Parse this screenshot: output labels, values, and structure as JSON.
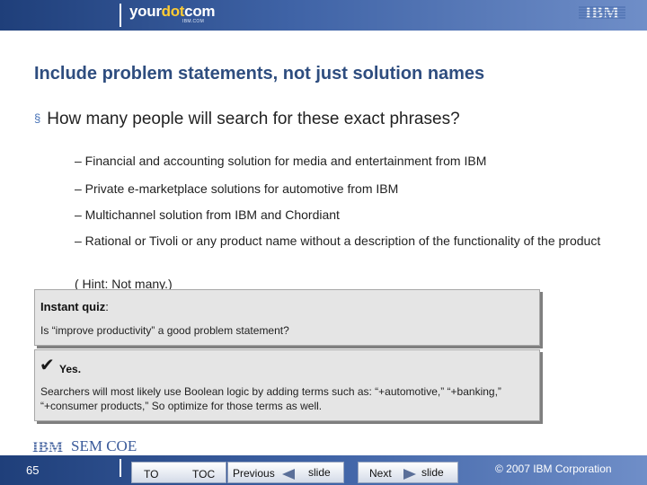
{
  "header": {
    "logo_prefix": "your",
    "logo_dot": "dot",
    "logo_suffix": "com",
    "logo_sub": "IBM.COM",
    "brand": "IBM"
  },
  "slide": {
    "title": "Include problem statements, not just solution names",
    "bullet_marker": "§",
    "bullet": "How many people will search for these exact phrases?",
    "sub_items": [
      "– Financial and accounting solution for media and entertainment from IBM",
      "– Private e-marketplace solutions for automotive from IBM",
      "– Multichannel solution from IBM and Chordiant",
      "– Rational or Tivoli or any product name without a description of the functionality of the product",
      "( Hint: Not many.)"
    ]
  },
  "quiz": {
    "label": "Instant quiz",
    "colon": ":",
    "question": "Is “improve productivity” a good problem statement?"
  },
  "answer": {
    "check": "✔",
    "yes": "Yes.",
    "text": "Searchers will most likely use Boolean logic by adding terms such as: “+automotive,” “+banking,” “+consumer products,” So optimize for those terms as well."
  },
  "footer": {
    "ibm": "IBM",
    "sem_coe": "SEM COE",
    "page_number": "65",
    "to_label": "TO",
    "toc_label": "TOC",
    "previous_label": "Previous",
    "previous_slide_label": "slide",
    "next_label": "Next",
    "next_slide_label": "slide",
    "copyright": "© 2007 IBM Corporation"
  },
  "colors": {
    "header_blue": "#2e4d7f",
    "accent": "#4a74b8",
    "box_gray": "#e5e5e5"
  }
}
